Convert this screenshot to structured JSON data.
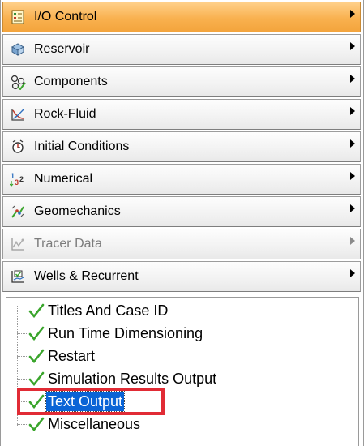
{
  "sections": [
    {
      "label": "I/O Control",
      "icon": "io-control-icon",
      "state": "active"
    },
    {
      "label": "Reservoir",
      "icon": "reservoir-icon",
      "state": "normal"
    },
    {
      "label": "Components",
      "icon": "components-icon",
      "state": "normal"
    },
    {
      "label": "Rock-Fluid",
      "icon": "rock-fluid-icon",
      "state": "normal"
    },
    {
      "label": "Initial Conditions",
      "icon": "initial-conditions-icon",
      "state": "normal"
    },
    {
      "label": "Numerical",
      "icon": "numerical-icon",
      "state": "normal"
    },
    {
      "label": "Geomechanics",
      "icon": "geomechanics-icon",
      "state": "normal"
    },
    {
      "label": "Tracer Data",
      "icon": "tracer-data-icon",
      "state": "disabled"
    },
    {
      "label": "Wells & Recurrent",
      "icon": "wells-recurrent-icon",
      "state": "normal"
    }
  ],
  "tree": {
    "items": [
      {
        "label": "Titles And Case ID",
        "status": "valid"
      },
      {
        "label": "Run Time Dimensioning",
        "status": "valid"
      },
      {
        "label": "Restart",
        "status": "valid"
      },
      {
        "label": "Simulation Results Output",
        "status": "valid"
      },
      {
        "label": "Text Output",
        "status": "valid",
        "selected": true
      },
      {
        "label": "Miscellaneous",
        "status": "valid"
      }
    ]
  },
  "colors": {
    "active_section": "#f9b14f",
    "selection": "#0a64d6",
    "check_green": "#3aa52c",
    "highlight_box": "#e12b35"
  }
}
